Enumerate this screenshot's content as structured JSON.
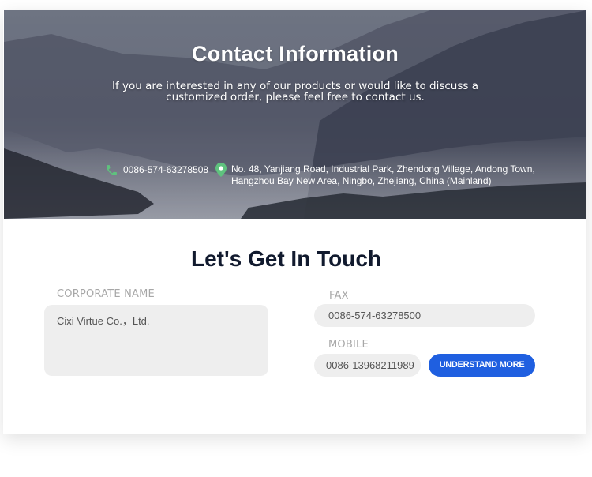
{
  "hero": {
    "title": "Contact Information",
    "subtitle": "If you are interested in any of our products or would like to discuss a customized order, please feel free to contact us.",
    "phone": "0086-574-63278508",
    "address": "No. 48, Yanjiang Road, Industrial Park, Zhendong Village, Andong Town, Hangzhou Bay New Area, Ningbo, Zhejiang, China (Mainland)"
  },
  "form": {
    "title": "Let's Get In Touch",
    "corporate_label": "CORPORATE NAME",
    "corporate_value": "Cixi Virtue Co.，Ltd.",
    "fax_label": "FAX",
    "fax_value": "0086-574-63278500",
    "mobile_label": "MOBILE",
    "mobile_value": "0086-13968211989",
    "button_label": "UNDERSTAND MORE"
  },
  "colors": {
    "accent": "#1f5fe0",
    "heading": "#111a2e",
    "icon_green": "#5fc27e"
  },
  "icons": {
    "phone": "phone-icon",
    "location": "location-pin-icon"
  }
}
